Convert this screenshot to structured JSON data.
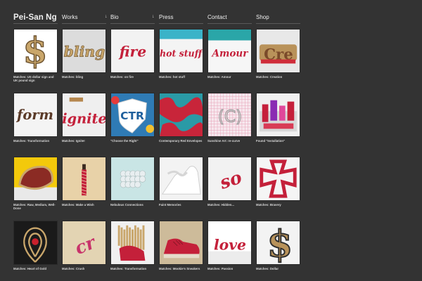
{
  "site": {
    "title": "Pei-San Ng"
  },
  "nav": [
    {
      "label": "Works",
      "dropdown": true
    },
    {
      "label": "Bio",
      "dropdown": true
    },
    {
      "label": "Press",
      "dropdown": false
    },
    {
      "label": "Contact",
      "dropdown": false
    },
    {
      "label": "Shop",
      "dropdown": false
    }
  ],
  "colors": {
    "background": "#333333",
    "text": "#f0f0f0",
    "match_red": "#c4203a",
    "match_tan": "#c9a66b"
  },
  "gallery": [
    {
      "caption": "Matches: US dollar sign and UK pound sign",
      "icon": "dollar-sign-icon"
    },
    {
      "caption": "Matches: bling",
      "icon": "bling-word-icon"
    },
    {
      "caption": "Matches: on fire",
      "icon": "fire-word-icon"
    },
    {
      "caption": "Matches: hot stuff",
      "icon": "hot-stuff-word-icon"
    },
    {
      "caption": "Matches: Amour",
      "icon": "amour-word-icon"
    },
    {
      "caption": "Matches: Creation",
      "icon": "creation-sculpture-icon"
    },
    {
      "caption": "Matches: Transformation",
      "icon": "form-word-icon"
    },
    {
      "caption": "Matches: Ignite!",
      "icon": "ignite-word-icon"
    },
    {
      "caption": "\"Choose the Right\"",
      "icon": "ctr-shield-icon"
    },
    {
      "caption": "Contemporary Red Envelopes",
      "icon": "red-envelope-pattern-icon"
    },
    {
      "caption": "Sunshine Art: re-curve",
      "icon": "curve-drawing-icon"
    },
    {
      "caption": "Found \"Installation\"",
      "icon": "installation-icon"
    },
    {
      "caption": "Matches: Raw, Medium, Well-Done",
      "icon": "steak-icon"
    },
    {
      "caption": "Matches: Make a Wish",
      "icon": "birthday-candle-icon"
    },
    {
      "caption": "Nebulous Connections",
      "icon": "glass-cluster-icon"
    },
    {
      "caption": "Faint Memories",
      "icon": "paper-relief-icon"
    },
    {
      "caption": "Matches: Hidden...",
      "icon": "hidden-word-icon"
    },
    {
      "caption": "Matches: Bravery",
      "icon": "maltese-cross-icon"
    },
    {
      "caption": "Matches: Heart of Gold",
      "icon": "heart-of-gold-icon"
    },
    {
      "caption": "Matches: Crush",
      "icon": "crush-word-icon"
    },
    {
      "caption": "Matches: Transformation",
      "icon": "transformation-sculpture-icon"
    },
    {
      "caption": "Matches: Mookie's Sneakers",
      "icon": "sneaker-icon"
    },
    {
      "caption": "Matches: Passion",
      "icon": "love-word-icon"
    },
    {
      "caption": "Matches: Dollar",
      "icon": "dollar-sign-3d-icon"
    }
  ]
}
